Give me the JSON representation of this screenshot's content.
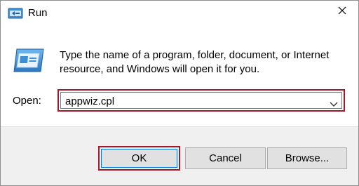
{
  "window": {
    "title": "Run",
    "title_icon": "run-icon",
    "close_icon": "close-icon"
  },
  "content": {
    "icon": "run-program-icon",
    "message": "Type the name of a program, folder, document, or Internet resource, and Windows will open it for you.",
    "open_label": "Open:",
    "open_value": "appwiz.cpl",
    "dropdown_icon": "chevron-down-icon"
  },
  "buttons": {
    "ok": "OK",
    "cancel": "Cancel",
    "browse": "Browse..."
  },
  "colors": {
    "highlight_border": "#a01a2a",
    "footer_bg": "#f0f0f0",
    "button_bg": "#e1e1e1"
  }
}
